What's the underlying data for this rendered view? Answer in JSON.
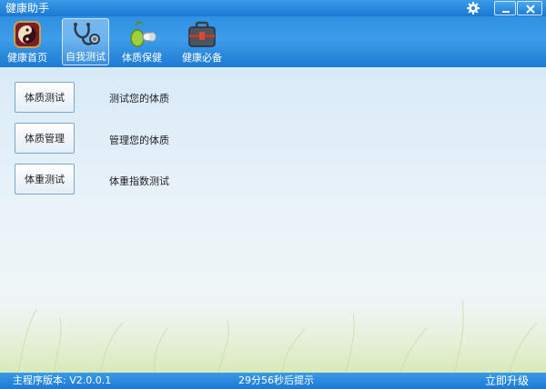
{
  "window": {
    "title": "健康助手"
  },
  "toolbar": {
    "items": [
      {
        "label": "健康首页",
        "icon": "yin-yang-icon"
      },
      {
        "label": "自我测试",
        "icon": "stethoscope-icon"
      },
      {
        "label": "体质保健",
        "icon": "pills-icon"
      },
      {
        "label": "健康必备",
        "icon": "first-aid-kit-icon"
      }
    ],
    "active_index": 1
  },
  "main": {
    "rows": [
      {
        "button": "体质测试",
        "description": "测试您的体质"
      },
      {
        "button": "体质管理",
        "description": "管理您的体质"
      },
      {
        "button": "体重测试",
        "description": "体重指数测试"
      }
    ]
  },
  "statusbar": {
    "version": "主程序版本: V2.0.0.1",
    "countdown": "29分56秒后提示",
    "upgrade": "立即升级"
  },
  "colors": {
    "accent": "#1e7ad4",
    "button_border": "#7fa7c9"
  }
}
